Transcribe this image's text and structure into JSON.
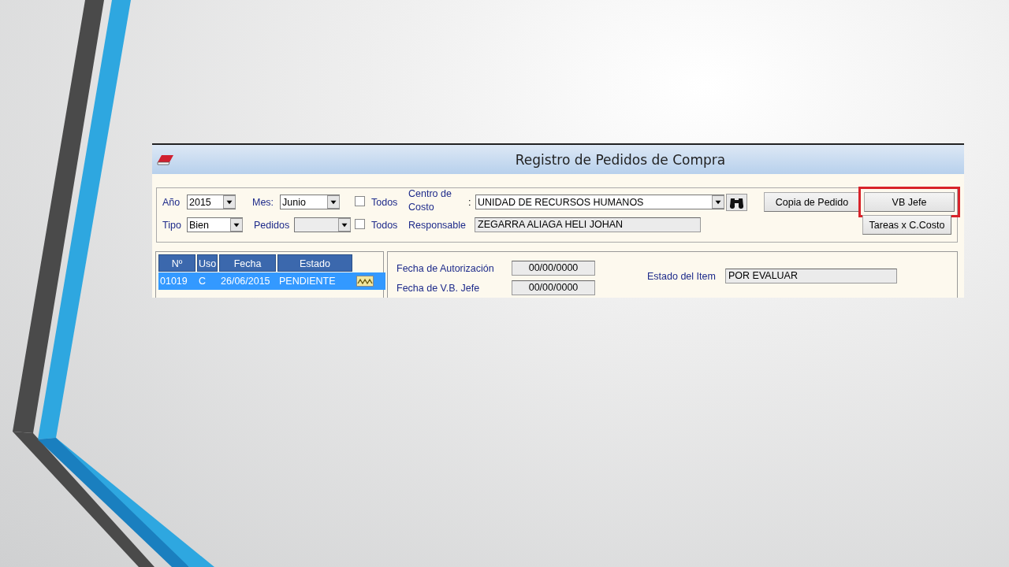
{
  "window": {
    "title": "Registro de Pedidos de Compra"
  },
  "filters": {
    "year": {
      "label": "Año",
      "value": "2015"
    },
    "month": {
      "label": "Mes:",
      "value": "Junio"
    },
    "all_months": {
      "label": "Todos",
      "checked": false
    },
    "cost_center": {
      "label": "Centro de Costo",
      "separator": ":",
      "value": "UNIDAD DE RECURSOS HUMANOS"
    },
    "type": {
      "label": "Tipo",
      "value": "Bien"
    },
    "orders": {
      "label": "Pedidos"
    },
    "all_orders": {
      "label": "Todos",
      "checked": false
    },
    "responsible": {
      "label": "Responsable",
      "value": "ZEGARRA ALIAGA HELI JOHAN"
    }
  },
  "buttons": [
    {
      "label": "Copia de Pedido",
      "highlighted": false
    },
    {
      "label": "VB Jefe",
      "highlighted": true
    },
    {
      "label": "Tareas x C.Costo",
      "highlighted": false
    }
  ],
  "orders_table": {
    "columns": [
      "Nº",
      "Uso",
      "Fecha",
      "Estado"
    ],
    "rows": [
      {
        "cells": [
          "01019",
          "C",
          "26/06/2015",
          "PENDIENTE"
        ],
        "selected": true
      }
    ]
  },
  "details": [
    {
      "label": "Fecha de Autorización",
      "value": "00/00/0000"
    },
    {
      "label": "Fecha de V.B. Jefe",
      "value": "00/00/0000"
    }
  ],
  "item_status": {
    "label": "Estado del Item",
    "value": "POR EVALUAR"
  }
}
